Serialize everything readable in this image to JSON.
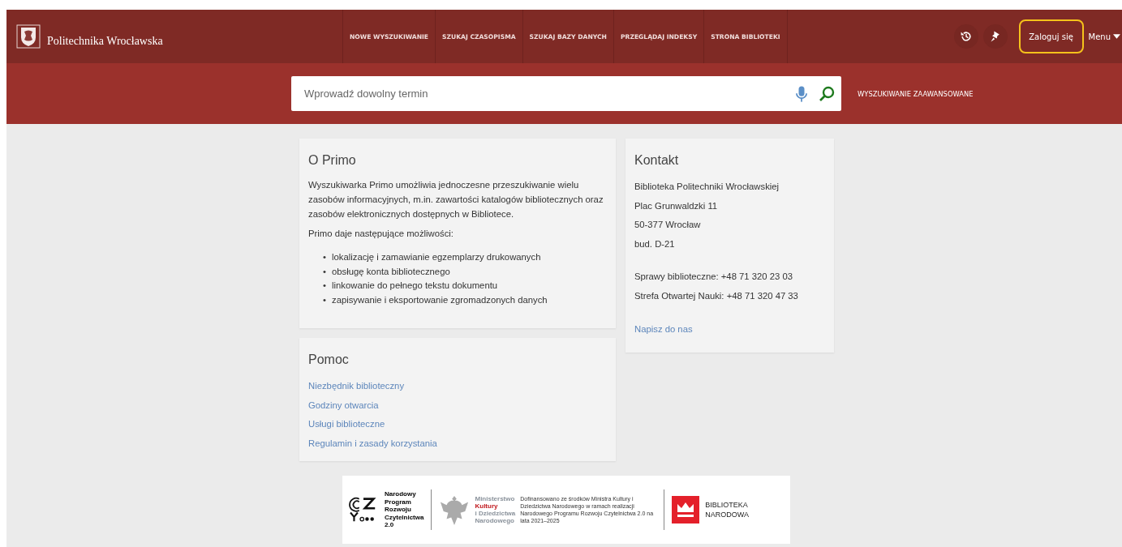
{
  "header": {
    "logo_text": "Politechnika Wrocławska",
    "nav": [
      "NOWE WYSZUKIWANIE",
      "SZUKAJ CZASOPISMA",
      "SZUKAJ BAZY DANYCH",
      "PRZEGLĄDAJ INDEKSY",
      "STRONA BIBLIOTEKI"
    ],
    "login": {
      "label": "Zaloguj się",
      "highlighted": true
    },
    "menu": "Menu"
  },
  "search": {
    "placeholder": "Wprowadź dowolny termin",
    "advanced": "WYSZUKIWANIE ZAAWANSOWANE"
  },
  "about": {
    "title": "O Primo",
    "intro": "Wyszukiwarka Primo umożliwia jednoczesne przeszukiwanie wielu zasobów informacyjnych, m.in. zawartości katalogów bibliotecznych oraz zasobów elektronicznych dostępnych w Bibliotece.",
    "lead": "Primo daje następujące możliwości:",
    "bullet": "•",
    "items": [
      "lokalizację i zamawianie egzemplarzy drukowanych",
      "obsługę konta bibliotecznego",
      "linkowanie do pełnego tekstu dokumentu",
      "zapisywanie i eksportowanie zgromadzonych danych"
    ]
  },
  "help": {
    "title": "Pomoc",
    "links": [
      "Niezbędnik biblioteczny",
      "Godziny otwarcia",
      "Usługi biblioteczne",
      "Regulamin i zasady korzystania"
    ]
  },
  "contact": {
    "title": "Kontakt",
    "address": [
      "Biblioteka Politechniki Wrocławskiej",
      "Plac Grunwaldzki 11",
      "50-377 Wrocław",
      "bud. D-21"
    ],
    "phones": [
      "Sprawy biblioteczne: +48 71 320 23 03",
      "Strefa Otwartej Nauki: +48 71 320 47 33"
    ],
    "link": "Napisz do nas"
  },
  "footer": {
    "program": [
      "Narodowy",
      "Program",
      "Rozwoju",
      "Czytelnictwa",
      "2.0"
    ],
    "ministry": [
      {
        "text": "Ministerstwo",
        "kind": "grey"
      },
      {
        "text": "Kultury",
        "kind": "red"
      },
      {
        "text": "i Dziedzictwa",
        "kind": "grey"
      },
      {
        "text": "Narodowego",
        "kind": "grey"
      }
    ],
    "funding": "Dofinansowano ze środków Ministra Kultury i Dziedzictwa Narodowego w ramach realizacji Narodowego Programu Rozwoju Czytelnictwa 2.0 na lata 2021–2025",
    "library": [
      "BIBLIOTEKA",
      "NARODOWA"
    ]
  }
}
